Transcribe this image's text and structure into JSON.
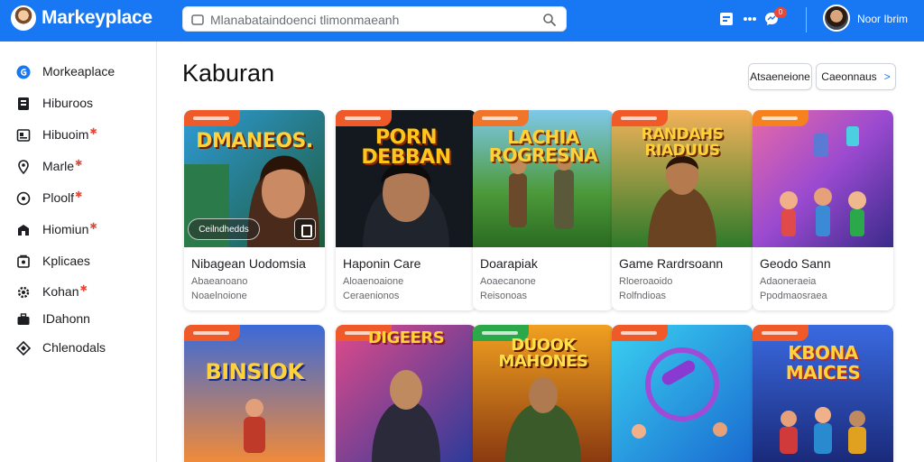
{
  "header": {
    "app_title": "Markeyplace",
    "search_placeholder": "Mlanabataindoenci tlimonmaeanh",
    "notification_count": "0",
    "user_name": "Noor Ibrim",
    "colors": {
      "brand": "#1877f2",
      "badge": "#e4493b"
    }
  },
  "sidebar": {
    "items": [
      {
        "label": "Morkeaplace",
        "icon": "marketplace-icon",
        "dot": false
      },
      {
        "label": "Hiburoos",
        "icon": "browse-icon",
        "dot": false
      },
      {
        "label": "Hibuoim",
        "icon": "inbox-icon",
        "dot": true
      },
      {
        "label": "Marle",
        "icon": "location-icon",
        "dot": true
      },
      {
        "label": "Ploolf",
        "icon": "notification-icon",
        "dot": true
      },
      {
        "label": "Hiomiun",
        "icon": "buying-icon",
        "dot": true
      },
      {
        "label": "Kplicaes",
        "icon": "selling-icon",
        "dot": false
      },
      {
        "label": "Kohan",
        "icon": "settings-icon",
        "dot": true
      },
      {
        "label": "IDahonn",
        "icon": "briefcase-icon",
        "dot": false
      },
      {
        "label": "Chlenodals",
        "icon": "categories-icon",
        "dot": false
      }
    ]
  },
  "main": {
    "title": "Kaburan",
    "action_button": "Atsaeneione",
    "secondary_button": "Caeonnaus",
    "cards": [
      {
        "title": "Nibagean Uodomsia",
        "sub1": "Abaeanoano",
        "sub2": "Noaelnoione",
        "banner": "DMANEOS.",
        "overlay_button": "Ceilndhedds",
        "tag_color": "#f05a28"
      },
      {
        "title": "Haponin Care",
        "sub1": "Aloaenoaione",
        "sub2": "Ceraenionos",
        "banner": "PORN DEBBAN",
        "tag_color": "#f05a28"
      },
      {
        "title": "Doarapiak",
        "sub1": "Aoaecanone",
        "sub2": "Reisonoas",
        "banner": "LACHIA ROGRESNA",
        "tag_color": "#f0742a"
      },
      {
        "title": "Game Rardrsoann",
        "sub1": "Rloeroaoido",
        "sub2": "Rolfndioas",
        "banner": "RANDAHS RIADUUS",
        "tag_color": "#f05a28"
      },
      {
        "title": "Geodo Sann",
        "sub1": "Adaoneraeia",
        "sub2": "Ppodmaosraea",
        "banner": "",
        "tag_color": "#f5821f"
      },
      {
        "title": "",
        "sub1": "",
        "sub2": "",
        "banner": "BINSIOK",
        "tag_color": "#f05a28"
      },
      {
        "title": "",
        "sub1": "",
        "sub2": "",
        "banner": "DIGEERS",
        "tag_color": "#f05a28"
      },
      {
        "title": "",
        "sub1": "",
        "sub2": "",
        "banner": "DUOOK MAHONES",
        "tag_color": "#2aa84a"
      },
      {
        "title": "",
        "sub1": "",
        "sub2": "",
        "banner": "",
        "tag_color": "#f05a28"
      },
      {
        "title": "",
        "sub1": "",
        "sub2": "",
        "banner": "KBONA MAICES",
        "tag_color": "#f05a28"
      }
    ]
  }
}
